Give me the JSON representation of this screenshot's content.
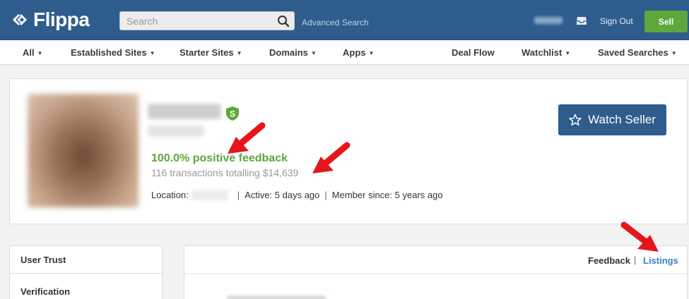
{
  "header": {
    "logo_text": "Flippa",
    "search_placeholder": "Search",
    "advanced_search": "Advanced Search",
    "sign_out": "Sign Out",
    "sell_label": "Sell"
  },
  "nav": {
    "all": "All",
    "established_sites": "Established Sites",
    "starter_sites": "Starter Sites",
    "domains": "Domains",
    "apps": "Apps",
    "deal_flow": "Deal Flow",
    "watchlist": "Watchlist",
    "saved_searches": "Saved Searches"
  },
  "profile": {
    "verified_badge": "S",
    "feedback": "100.0% positive feedback",
    "transactions": "116 transactions totalling $14,639",
    "location_label": "Location:",
    "active": "Active: 5 days ago",
    "member_since": "Member since: 5 years ago",
    "watch_seller": "Watch Seller"
  },
  "sidebar": {
    "user_trust": "User Trust",
    "verification": "Verification"
  },
  "tabs": {
    "feedback": "Feedback",
    "separator": "|",
    "listings": "Listings"
  },
  "colors": {
    "header_bg": "#2e5c8d",
    "sell_green": "#5da83b",
    "feedback_green": "#5da83b",
    "link_blue": "#3b80c6",
    "annotation_red": "#e8141c"
  }
}
